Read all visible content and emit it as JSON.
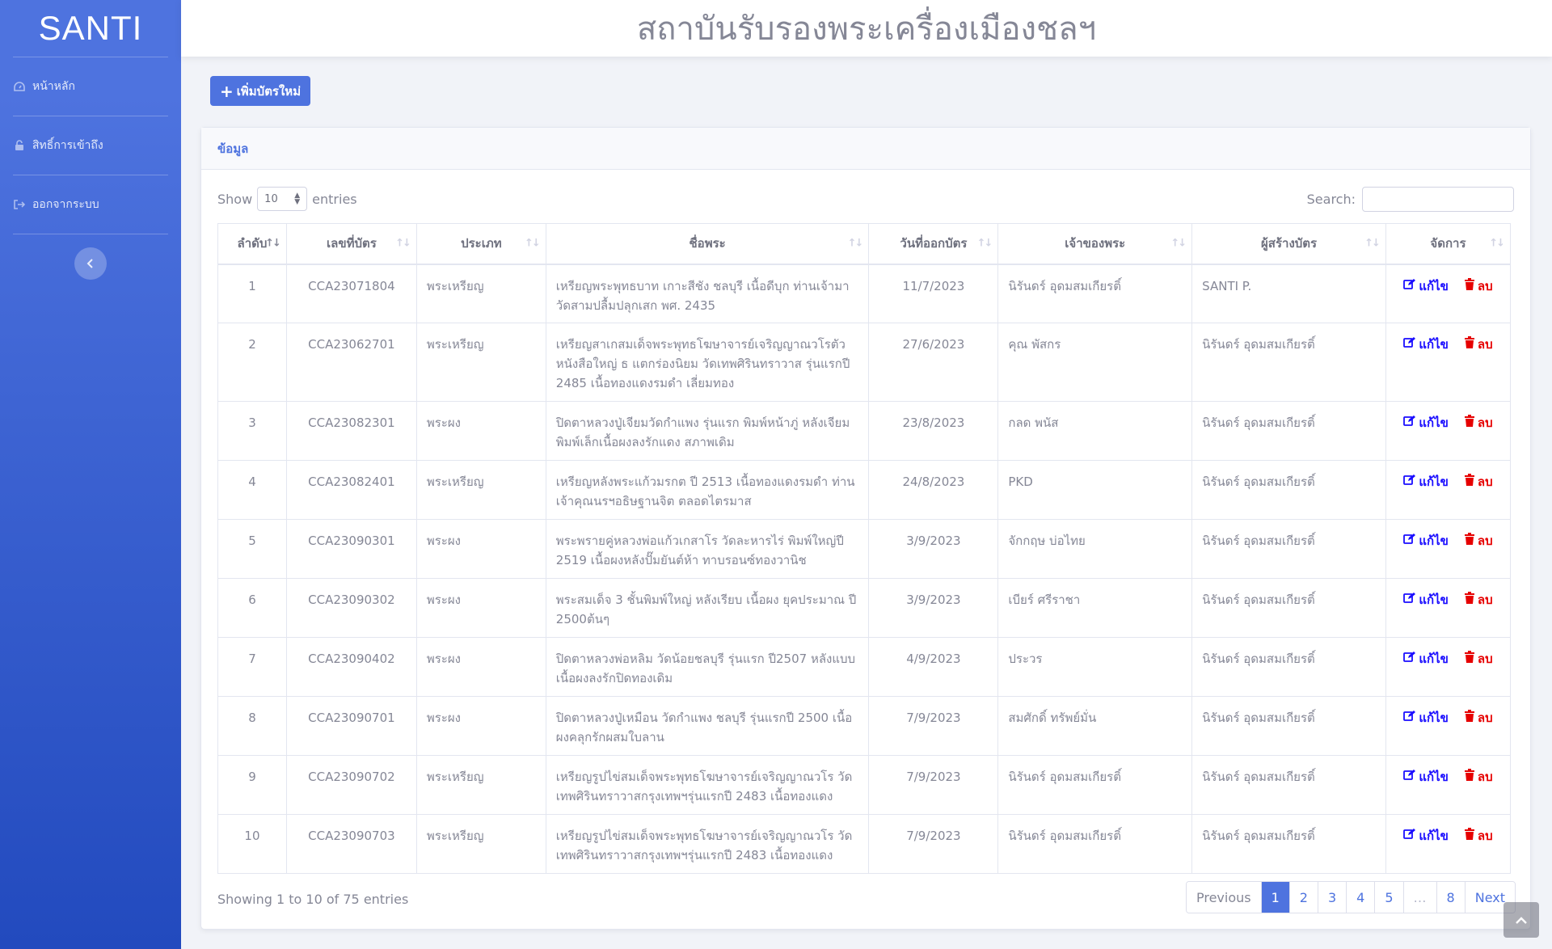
{
  "sidebar": {
    "brand": "SANTI",
    "items": [
      {
        "label": "หน้าหลัก",
        "icon": "dashboard-icon"
      },
      {
        "label": "สิทธิ์การเข้าถึง",
        "icon": "lock-icon"
      },
      {
        "label": "ออกจากระบบ",
        "icon": "sign-out-icon"
      }
    ],
    "toggle_icon": "chevron-left-icon"
  },
  "header": {
    "title": "สถาบันรับรองพระเครื่องเมืองชลฯ"
  },
  "toolbar": {
    "add_label": "เพิ่มบัตรใหม่"
  },
  "card": {
    "title": "ข้อมูล"
  },
  "table_controls": {
    "show_label": "Show",
    "page_size": "10",
    "entries_label": "entries",
    "search_label": "Search:",
    "search_value": ""
  },
  "table": {
    "columns": [
      "ลำดับ",
      "เลขที่บัตร",
      "ประเภท",
      "ชื่อพระ",
      "วันที่ออกบัตร",
      "เจ้าของพระ",
      "ผู้สร้างบัตร",
      "จัดการ"
    ],
    "edit_label": "แก้ไข",
    "delete_label": "ลบ",
    "rows": [
      {
        "no": "1",
        "card_no": "CCA23071804",
        "type": "พระเหรียญ",
        "name": "เหรียญพระพุทธบาท เกาะสีชัง ชลบุรี เนื้อดีบุก ท่านเจ้ามา วัดสามปลื้มปลุกเสก พศ. 2435",
        "date": "11/7/2023",
        "owner": "นิรันดร์ อุดมสมเกียรติ์",
        "creator": "SANTI P."
      },
      {
        "no": "2",
        "card_no": "CCA23062701",
        "type": "พระเหรียญ",
        "name": "เหรียญสาเกสมเด็จพระพุทธโฆษาจารย์เจริญญาณวโรตัว หนังสือใหญ่ ธ แตกร่องนิยม วัดเทพศิรินทราวาส รุ่นแรกปี 2485 เนื้อทองแดงรมดำ เลี่ยมทอง",
        "date": "27/6/2023",
        "owner": "คุณ พัสกร",
        "creator": "นิรันดร์ อุดมสมเกียรติ์"
      },
      {
        "no": "3",
        "card_no": "CCA23082301",
        "type": "พระผง",
        "name": "ปิดตาหลวงปู่เจียมวัดกำแพง รุ่นแรก พิมพ์หน้าภู่ หลังเจียม พิมพ์เล็กเนื้อผงลงรักแดง สภาพเดิม",
        "date": "23/8/2023",
        "owner": "กลด พนัส",
        "creator": "นิรันดร์ อุดมสมเกียรติ์"
      },
      {
        "no": "4",
        "card_no": "CCA23082401",
        "type": "พระเหรียญ",
        "name": "เหรียญหลังพระแก้วมรกต ปี 2513 เนื้อทองแดงรมดำ ท่านเจ้าคุณนรฯอธิษฐานจิต ตลอดไตรมาส",
        "date": "24/8/2023",
        "owner": "PKD",
        "creator": "นิรันดร์ อุดมสมเกียรติ์"
      },
      {
        "no": "5",
        "card_no": "CCA23090301",
        "type": "พระผง",
        "name": "พระพรายคู่หลวงพ่อแก้วเกสาโร วัดละหารไร่ พิมพ์ใหญ่ปี 2519 เนื้อผงหลังปั๊มยันต์ห้า ทาบรอนซ์ทองวานิช",
        "date": "3/9/2023",
        "owner": "จักกฤษ บ่อไทย",
        "creator": "นิรันดร์ อุดมสมเกียรติ์"
      },
      {
        "no": "6",
        "card_no": "CCA23090302",
        "type": "พระผง",
        "name": "พระสมเด็จ 3 ชั้นพิมพ์ใหญ่ หลังเรียบ เนื้อผง ยุคประมาณ ปี 2500ต้นๆ",
        "date": "3/9/2023",
        "owner": "เบียร์ ศรีราชา",
        "creator": "นิรันดร์ อุดมสมเกียรติ์"
      },
      {
        "no": "7",
        "card_no": "CCA23090402",
        "type": "พระผง",
        "name": "ปิดตาหลวงพ่อหลิม วัดน้อยชลบุรี รุ่นแรก ปี2507 หลังแบบ เนื้อผงลงรักปิดทองเดิม",
        "date": "4/9/2023",
        "owner": "ประวร",
        "creator": "นิรันดร์ อุดมสมเกียรติ์"
      },
      {
        "no": "8",
        "card_no": "CCA23090701",
        "type": "พระผง",
        "name": "ปิดตาหลวงปู่เหมือน วัดกำแพง ชลบุรี รุ่นแรกปี 2500 เนื้อผงคลุกรักผสมใบลาน",
        "date": "7/9/2023",
        "owner": "สมศักดิ์ ทรัพย์มั่น",
        "creator": "นิรันดร์ อุดมสมเกียรติ์"
      },
      {
        "no": "9",
        "card_no": "CCA23090702",
        "type": "พระเหรียญ",
        "name": "เหรียญรูปไข่สมเด็จพระพุทธโฆษาจารย์เจริญญาณวโร วัดเทพศิรินทราวาสกรุงเทพฯรุ่นแรกปี 2483 เนื้อทองแดง",
        "date": "7/9/2023",
        "owner": "นิรันดร์ อุดมสมเกียรติ์",
        "creator": "นิรันดร์ อุดมสมเกียรติ์"
      },
      {
        "no": "10",
        "card_no": "CCA23090703",
        "type": "พระเหรียญ",
        "name": "เหรียญรูปไข่สมเด็จพระพุทธโฆษาจารย์เจริญญาณวโร วัดเทพศิรินทราวาสกรุงเทพฯรุ่นแรกปี 2483 เนื้อทองแดง",
        "date": "7/9/2023",
        "owner": "นิรันดร์ อุดมสมเกียรติ์",
        "creator": "นิรันดร์ อุดมสมเกียรติ์"
      }
    ]
  },
  "footer": {
    "info": "Showing 1 to 10 of 75 entries",
    "pagination": [
      "Previous",
      "1",
      "2",
      "3",
      "4",
      "5",
      "…",
      "8",
      "Next"
    ],
    "active_page": "1"
  },
  "colors": {
    "primary": "#4e73df",
    "edit": "#1a0dff",
    "delete": "#e60000"
  }
}
